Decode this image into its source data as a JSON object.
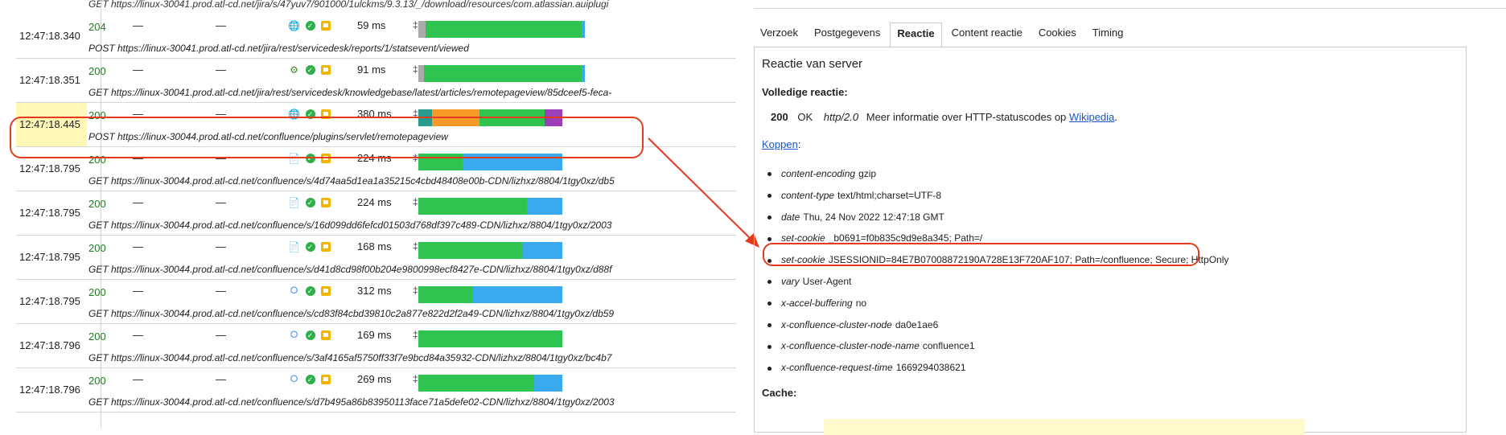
{
  "top_url": "GET https://linux-30041.prod.atl-cd.net/jira/s/47yuv7/901000/1ulckms/9.3.13/_/download/resources/com.atlassian.auiplugi",
  "rows": [
    {
      "time": "12:47:18.340",
      "status": "204",
      "dash1": "—",
      "dash2": "—",
      "type": "globe",
      "ms": "59 ms",
      "url": "POST https://linux-30041.prod.atl-cd.net/jira/rest/servicedesk/reports/1/statsevent/viewed",
      "bars": [
        {
          "color": "#aaaaaa",
          "w": 4
        },
        {
          "color": "#2fc44f",
          "w": 89
        },
        {
          "color": "#3aaaee",
          "w": 2
        }
      ]
    },
    {
      "time": "12:47:18.351",
      "status": "200",
      "dash1": "—",
      "dash2": "—",
      "type": "gear",
      "ms": "91 ms",
      "url": "GET https://linux-30041.prod.atl-cd.net/jira/rest/servicedesk/knowledgebase/latest/articles/remotepageview/85dceef5-feca-",
      "bars": [
        {
          "color": "#aaaaaa",
          "w": 3
        },
        {
          "color": "#2fc44f",
          "w": 90
        },
        {
          "color": "#3aaaee",
          "w": 2
        }
      ]
    },
    {
      "time": "12:47:18.445",
      "status": "200",
      "dash1": "—",
      "dash2": "—",
      "type": "globe",
      "ms": "380 ms",
      "url": "POST https://linux-30044.prod.atl-cd.net/confluence/plugins/servlet/remotepageview",
      "selected": true,
      "bars": [
        {
          "color": "#2a9a8f",
          "w": 8
        },
        {
          "color": "#f79a28",
          "w": 27
        },
        {
          "color": "#2fc44f",
          "w": 37
        },
        {
          "color": "#9a3fb8",
          "w": 10
        }
      ]
    },
    {
      "time": "12:47:18.795",
      "status": "200",
      "dash1": "—",
      "dash2": "—",
      "type": "doc",
      "ms": "224 ms",
      "url": "GET https://linux-30044.prod.atl-cd.net/confluence/s/4d74aa5d1ea1a35215c4cbd48408e00b-CDN/lizhxz/8804/1tgy0xz/db5",
      "bars": [
        {
          "color": "#2fc44f",
          "w": 25
        },
        {
          "color": "#3aaaee",
          "w": 57
        }
      ]
    },
    {
      "time": "12:47:18.795",
      "status": "200",
      "dash1": "—",
      "dash2": "—",
      "type": "doc",
      "ms": "224 ms",
      "url": "GET https://linux-30044.prod.atl-cd.net/confluence/s/16d099dd6fefcd01503d768df397c489-CDN/lizhxz/8804/1tgy0xz/2003",
      "bars": [
        {
          "color": "#2fc44f",
          "w": 62
        },
        {
          "color": "#3aaaee",
          "w": 20
        }
      ]
    },
    {
      "time": "12:47:18.795",
      "status": "200",
      "dash1": "—",
      "dash2": "—",
      "type": "doc",
      "ms": "168 ms",
      "url": "GET https://linux-30044.prod.atl-cd.net/confluence/s/d41d8cd98f00b204e9800998ecf8427e-CDN/lizhxz/8804/1tgy0xz/d88f",
      "bars": [
        {
          "color": "#2fc44f",
          "w": 59
        },
        {
          "color": "#3aaaee",
          "w": 23
        }
      ]
    },
    {
      "time": "12:47:18.795",
      "status": "200",
      "dash1": "—",
      "dash2": "—",
      "type": "code",
      "ms": "312 ms",
      "url": "GET https://linux-30044.prod.atl-cd.net/confluence/s/cd83f84cbd39810c2a877e822d2f2a49-CDN/lizhxz/8804/1tgy0xz/db59",
      "bars": [
        {
          "color": "#2fc44f",
          "w": 31
        },
        {
          "color": "#3aaaee",
          "w": 51
        }
      ]
    },
    {
      "time": "12:47:18.796",
      "status": "200",
      "dash1": "—",
      "dash2": "—",
      "type": "code",
      "ms": "169 ms",
      "url": "GET https://linux-30044.prod.atl-cd.net/confluence/s/3af4165af5750ff33f7e9bcd84a35932-CDN/lizhxz/8804/1tgy0xz/bc4b7",
      "bars": [
        {
          "color": "#2fc44f",
          "w": 82
        }
      ]
    },
    {
      "time": "12:47:18.796",
      "status": "200",
      "dash1": "—",
      "dash2": "—",
      "type": "code",
      "ms": "269 ms",
      "url": "GET https://linux-30044.prod.atl-cd.net/confluence/s/d7b495a86b83950113face71a5defe02-CDN/lizhxz/8804/1tgy0xz/2003",
      "bars": [
        {
          "color": "#2fc44f",
          "w": 66
        },
        {
          "color": "#3aaaee",
          "w": 16
        }
      ]
    }
  ],
  "tabs": [
    "Verzoek",
    "Postgegevens",
    "Reactie",
    "Content reactie",
    "Cookies",
    "Timing"
  ],
  "active_tab": "Reactie",
  "panel": {
    "title": "Reactie van server",
    "full_label": "Volledige reactie:",
    "resp_code": "200",
    "resp_ok": "OK",
    "resp_proto": "http/2.0",
    "resp_more": "Meer informatie over HTTP-statuscodes op",
    "resp_link": "Wikipedia",
    "resp_dot": ".",
    "koppen": "Koppen",
    "koppen_colon": ":",
    "headers": [
      {
        "k": "content-encoding",
        "v": "gzip"
      },
      {
        "k": "content-type",
        "v": "text/html;charset=UTF-8"
      },
      {
        "k": "date",
        "v": "Thu, 24 Nov 2022 12:47:18 GMT"
      },
      {
        "k": "set-cookie",
        "v": "_b0691=f0b835c9d9e8a345; Path=/"
      },
      {
        "k": "set-cookie",
        "v": "JSESSIONID=84E7B07008872190A728E13F720AF107; Path=/confluence; Secure; HttpOnly"
      },
      {
        "k": "vary",
        "v": "User-Agent"
      },
      {
        "k": "x-accel-buffering",
        "v": "no"
      },
      {
        "k": "x-confluence-cluster-node",
        "v": "da0e1ae6"
      },
      {
        "k": "x-confluence-cluster-node-name",
        "v": "confluence1"
      },
      {
        "k": "x-confluence-request-time",
        "v": "1669294038621"
      }
    ],
    "cache_label": "Cache:"
  },
  "colors": {
    "highlight": "#e23b1e",
    "status_green": "#1e7c1e",
    "selected_time_bg": "#fff7b5"
  }
}
